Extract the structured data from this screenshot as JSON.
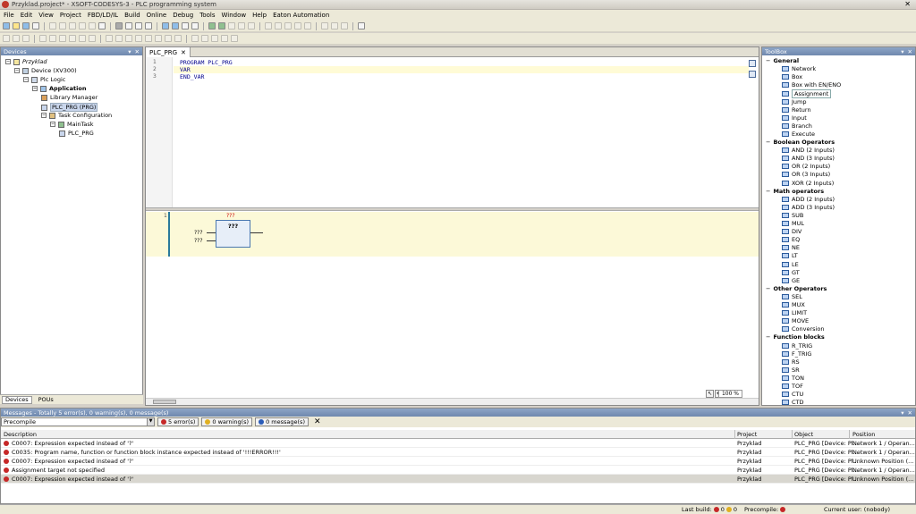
{
  "window": {
    "title": "Przyklad.project* - XSOFT-CODESYS-3 - PLC programming system"
  },
  "menu": [
    "File",
    "Edit",
    "View",
    "Project",
    "FBD/LD/IL",
    "Build",
    "Online",
    "Debug",
    "Tools",
    "Window",
    "Help",
    "Eaton Automation"
  ],
  "devices_panel": {
    "title": "Devices",
    "tree": [
      {
        "label": "Przyklad",
        "level": 0,
        "bold": false,
        "italic": true
      },
      {
        "label": "Device (XV300)",
        "level": 1,
        "bold": false
      },
      {
        "label": "Plc Logic",
        "level": 2,
        "bold": false
      },
      {
        "label": "Application",
        "level": 3,
        "bold": true
      },
      {
        "label": "Library Manager",
        "level": 4,
        "bold": false
      },
      {
        "label": "PLC_PRG (PRG)",
        "level": 4,
        "bold": false,
        "selected": true
      },
      {
        "label": "Task Configuration",
        "level": 4,
        "bold": false
      },
      {
        "label": "MainTask",
        "level": 5,
        "bold": false
      },
      {
        "label": "PLC_PRG",
        "level": 6,
        "bold": false
      }
    ],
    "tabs": [
      "Devices",
      "POUs"
    ]
  },
  "editor": {
    "tab_label": "PLC_PRG",
    "declaration": [
      {
        "num": "1",
        "text": "PROGRAM PLC_PRG"
      },
      {
        "num": "2",
        "text": "VAR"
      },
      {
        "num": "3",
        "text": "END_VAR"
      }
    ],
    "network": {
      "number": "1",
      "instance": "???",
      "box_name": "???",
      "input1": "???",
      "input2": "???"
    },
    "zoom": "100 %"
  },
  "toolbox": {
    "title": "ToolBox",
    "groups": [
      {
        "name": "General",
        "items": [
          "Network",
          "Box",
          "Box with EN/ENO",
          "Assignment",
          "Jump",
          "Return",
          "Input",
          "Branch",
          "Execute"
        ]
      },
      {
        "name": "Boolean Operators",
        "items": [
          "AND (2 Inputs)",
          "AND (3 Inputs)",
          "OR (2 Inputs)",
          "OR (3 Inputs)",
          "XOR (2 Inputs)"
        ]
      },
      {
        "name": "Math operators",
        "items": [
          "ADD (2 Inputs)",
          "ADD (3 Inputs)",
          "SUB",
          "MUL",
          "DIV",
          "EQ",
          "NE",
          "LT",
          "LE",
          "GT",
          "GE"
        ]
      },
      {
        "name": "Other Operators",
        "items": [
          "SEL",
          "MUX",
          "LIMIT",
          "MOVE",
          "Conversion"
        ]
      },
      {
        "name": "Function blocks",
        "items": [
          "R_TRIG",
          "F_TRIG",
          "RS",
          "SR",
          "TON",
          "TOF",
          "CTU",
          "CTD"
        ]
      }
    ],
    "selected_item": "Assignment"
  },
  "messages": {
    "title": "Messages - Totally 5 error(s), 0 warning(s), 0 message(s)",
    "filter": "Precompile",
    "errors_btn": "5 error(s)",
    "warnings_btn": "0 warning(s)",
    "messages_btn": "0 message(s)",
    "columns": [
      "Description",
      "Project",
      "Object",
      "Position"
    ],
    "rows": [
      {
        "desc": "C0007: Expression expected instead of '?'",
        "project": "Przyklad",
        "object": "PLC_PRG [Device: Pl...",
        "position": "Network 1 / Operan..."
      },
      {
        "desc": "C0035: Program name, function or function block instance expected instead of '!!!ERROR!!!'",
        "project": "Przyklad",
        "object": "PLC_PRG [Device: Pl...",
        "position": "Network 1 / Operan..."
      },
      {
        "desc": "C0007: Expression expected instead of '?'",
        "project": "Przyklad",
        "object": "PLC_PRG [Device: Pl...",
        "position": "Unknown Position (..."
      },
      {
        "desc": "Assignment target not specified",
        "project": "Przyklad",
        "object": "PLC_PRG [Device: Pl...",
        "position": "Network 1 / Operan..."
      },
      {
        "desc": "C0007: Expression expected instead of '?'",
        "project": "Przyklad",
        "object": "PLC_PRG [Device: Pl...",
        "position": "Unknown Position (..."
      }
    ]
  },
  "status": {
    "last_build_label": "Last build:",
    "last_build_errors": "0",
    "last_build_warnings": "0",
    "precompile_label": "Precompile:",
    "current_user": "Current user: (nobody)"
  }
}
